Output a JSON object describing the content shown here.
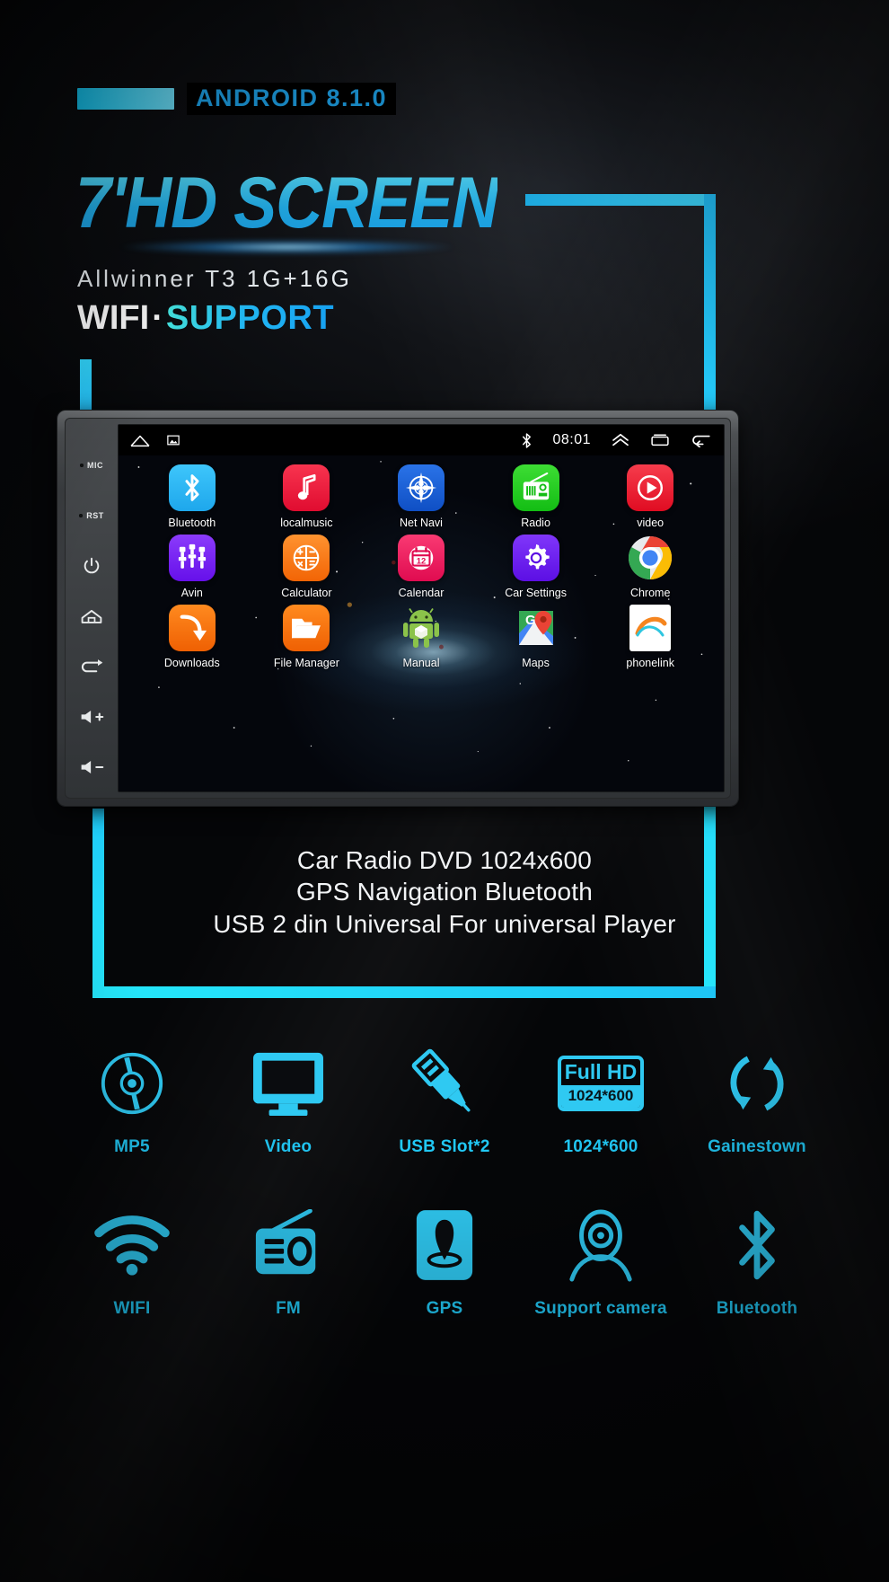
{
  "header": {
    "android_version": "ANDROID 8.1.0",
    "headline": "7'HD SCREEN",
    "spec": "Allwinner T3 1G+16G",
    "wifi_white": "WIFI",
    "wifi_dot": "·",
    "wifi_cyan": "SUPPORT"
  },
  "device": {
    "sidebar": [
      {
        "name": "mic",
        "label": "MIC",
        "type": "text"
      },
      {
        "name": "reset",
        "label": "RST",
        "type": "text"
      },
      {
        "name": "power",
        "label": "power-icon",
        "type": "icon"
      },
      {
        "name": "home",
        "label": "home-icon",
        "type": "icon"
      },
      {
        "name": "back",
        "label": "back-icon",
        "type": "icon"
      },
      {
        "name": "volume-up",
        "label": "volume-up-icon",
        "type": "icon"
      },
      {
        "name": "volume-down",
        "label": "volume-down-icon",
        "type": "icon"
      }
    ],
    "statusbar": {
      "home_icon": "home-icon",
      "gallery_icon": "image-icon",
      "bluetooth_icon": "bluetooth-icon",
      "time": "08:01",
      "chevron_icon": "chevron-up-icon",
      "recents_icon": "recents-icon",
      "back_icon": "back-arrow-icon"
    },
    "apps": [
      {
        "label": "Bluetooth",
        "icon": "bluetooth-icon",
        "bg": "#29b6f6"
      },
      {
        "label": "localmusic",
        "icon": "music-note-icon",
        "bg": "#f01a3c"
      },
      {
        "label": "Net Navi",
        "icon": "compass-icon",
        "bg": "#1560d8"
      },
      {
        "label": "Radio",
        "icon": "radio-icon",
        "bg": "#23c721"
      },
      {
        "label": "video",
        "icon": "play-circle-icon",
        "bg": "#ee1233"
      },
      {
        "label": "Avin",
        "icon": "rca-plugs-icon",
        "bg": "#7b22f0"
      },
      {
        "label": "Calculator",
        "icon": "calculator-icon",
        "bg": "#f97316"
      },
      {
        "label": "Calendar",
        "icon": "calendar-12-icon",
        "bg": "#ee2060"
      },
      {
        "label": "Car Settings",
        "icon": "gear-icon",
        "bg": "#6d22ee"
      },
      {
        "label": "Chrome",
        "icon": "chrome-icon",
        "bg": "#ffffff"
      },
      {
        "label": "Downloads",
        "icon": "download-arrow-icon",
        "bg": "#f3710c"
      },
      {
        "label": "File Manager",
        "icon": "folder-icon",
        "bg": "#f3710c"
      },
      {
        "label": "Manual",
        "icon": "android-robot-icon",
        "bg": "transparent"
      },
      {
        "label": "Maps",
        "icon": "google-maps-icon",
        "bg": "transparent"
      },
      {
        "label": "phonelink",
        "icon": "phonelink-icon",
        "bg": "#ffffff"
      }
    ]
  },
  "description": [
    "Car Radio DVD 1024x600",
    "GPS Navigation Bluetooth",
    "USB 2 din Universal For universal Player"
  ],
  "features_row1": [
    {
      "label": "MP5",
      "icon": "disc-icon"
    },
    {
      "label": "Video",
      "icon": "monitor-icon"
    },
    {
      "label": "USB Slot*2",
      "icon": "usb-plug-icon"
    },
    {
      "label": "1024*600",
      "icon": "full-hd-badge-icon",
      "badge_top": "Full HD",
      "badge_bottom": "1024*600"
    },
    {
      "label": "Gainestown",
      "icon": "refresh-icon"
    }
  ],
  "features_row2": [
    {
      "label": "WIFI",
      "icon": "wifi-icon"
    },
    {
      "label": "FM",
      "icon": "radio-icon"
    },
    {
      "label": "GPS",
      "icon": "gps-pin-icon"
    },
    {
      "label": "Support camera",
      "icon": "camera-icon"
    },
    {
      "label": "Bluetooth",
      "icon": "bluetooth-icon"
    }
  ],
  "colors": {
    "accent_cyan": "#21c8f5",
    "headline_blue": "#2bbdf5",
    "background": "#050507"
  }
}
